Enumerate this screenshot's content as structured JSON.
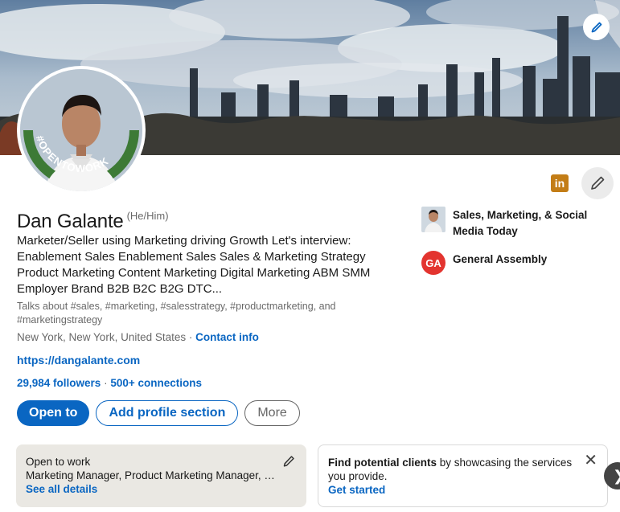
{
  "profile": {
    "name": "Dan Galante",
    "pronouns": "(He/Him)",
    "headline": "Marketer/Seller using Marketing driving Growth Let's interview: Enablement Sales Enablement Sales Sales & Marketing Strategy Product Marketing Content Marketing Digital Marketing ABM SMM Employer Brand B2B B2C B2G DTC...",
    "talks_about": "Talks about #sales, #marketing, #salesstrategy, #productmarketing, and #marketingstrategy",
    "location": "New York, New York, United States",
    "location_separator": " · ",
    "contact_info": "Contact info",
    "website": "https://dangalante.com",
    "followers": "29,984 followers",
    "connections": "500+ connections",
    "connections_separator": " · ",
    "open_to_work_badge": "#OPENTOWORK",
    "linkedin_logo_text": "in"
  },
  "actions": {
    "open_to": "Open to",
    "add_profile_section": "Add profile section",
    "more": "More"
  },
  "orgs": [
    {
      "name": "Sales, Marketing, & Social Media Today",
      "icon": "person-photo"
    },
    {
      "name": "General Assembly",
      "logo_text": "GA",
      "icon": "ga-logo"
    }
  ],
  "open_to_work_card": {
    "title": "Open to work",
    "body": "Marketing Manager, Product Marketing Manager, Digital Marketing Manager",
    "link": "See all details"
  },
  "clients_card": {
    "title_bold": "Find potential clients",
    "title_rest": " by showcasing the services you provide.",
    "link": "Get started",
    "close": "✕"
  },
  "carousel_next": "❯",
  "colors": {
    "brand_blue": "#0a66c2",
    "otw_green": "#3d7a36",
    "card_bg": "#eae8e3"
  }
}
